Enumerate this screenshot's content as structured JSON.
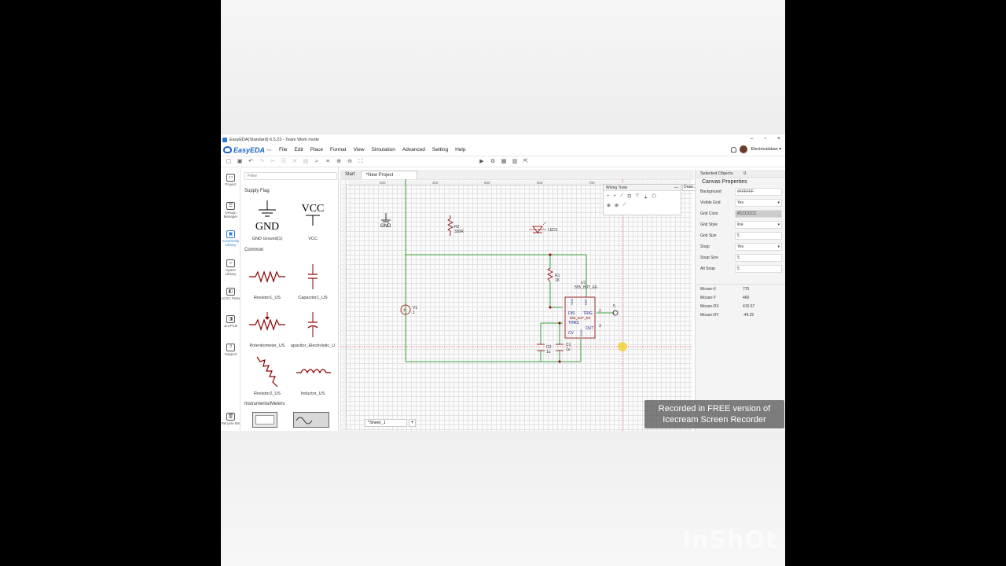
{
  "window": {
    "title": "EasyEDA(Standard) 6.5.23 - Team Work mode",
    "min": "–",
    "max": "▫",
    "close": "×"
  },
  "logo": {
    "text": "EasyEDA",
    "edition": "Std"
  },
  "menu": [
    "File",
    "Edit",
    "Place",
    "Format",
    "View",
    "Simulation",
    "Advanced",
    "Setting",
    "Help"
  ],
  "user": {
    "name": "Electricalsban ▾"
  },
  "rail": [
    {
      "label": "Project",
      "icon": "folder-icon"
    },
    {
      "label": "Design Manager",
      "icon": "tree-icon"
    },
    {
      "label": "Commonly Library",
      "icon": "chip-icon",
      "active": true
    },
    {
      "label": "Space Library",
      "icon": "search-icon"
    },
    {
      "label": "LCSC Parts",
      "icon": "lcsc-icon"
    },
    {
      "label": "JLCPCB",
      "icon": "jlc-icon"
    },
    {
      "label": "Support",
      "icon": "help-icon"
    },
    {
      "label": "Recycle Bin",
      "icon": "trash-icon"
    }
  ],
  "library": {
    "filter_placeholder": "Filter",
    "cat_supply": "Supply Flag",
    "cat_common": "Common",
    "cat_instruments": "Instruments/Meters",
    "items": [
      {
        "label": "GND Ground(1)"
      },
      {
        "label": "VCC"
      },
      {
        "label": "Resistor1_US"
      },
      {
        "label": "Capacitor1_US"
      },
      {
        "label": "Potentiometer_US"
      },
      {
        "label": "apacitor_Electrolytic_U"
      },
      {
        "label": "Resistor2_US"
      },
      {
        "label": "Inductor_US"
      }
    ]
  },
  "tabs": {
    "start": "Start",
    "project": "*New Project"
  },
  "ruler": {
    "t1": "300",
    "t2": "400",
    "t3": "500",
    "t4": "600",
    "t5": "700"
  },
  "sheet": {
    "name": "*Sheet_1",
    "add": "+"
  },
  "wiring": {
    "title": "Wiring Tools",
    "close": "—"
  },
  "draw": {
    "label": "Draw..."
  },
  "schematic": {
    "gnd": "GND",
    "r2_name": "R2",
    "r2_val": "330R",
    "led": "LED1",
    "r1_name": "R1",
    "r1_val": "1K",
    "v1": "V1",
    "v1_val": "1",
    "u1": "U1",
    "u1_part": "555_BJT_EE",
    "ic_part": "555_BJT_EE",
    "pin_dis": "DIS",
    "pin_thrs": "THRS",
    "pin_cv": "CV",
    "pin_trig": "TRIG",
    "pin_out": "OUT",
    "pin_vcc": "VCC",
    "pin_rst": "RST",
    "pin_gnd": "GND",
    "c2_name": "C2",
    "c2_val": "1u",
    "c1_name": "C1",
    "c1_val": "1u",
    "n2": "2",
    "n3": "3",
    "n5": "5"
  },
  "props": {
    "selected": "Selected Objects",
    "selected_count": "0",
    "title": "Canvas Properties",
    "rows": [
      {
        "key": "Background",
        "value": "#FFFFFF"
      },
      {
        "key": "Visible Grid",
        "value": "Yes"
      },
      {
        "key": "Grid Color",
        "value": "#CCCCCC"
      },
      {
        "key": "Grid Style",
        "value": "line"
      },
      {
        "key": "Grid Size",
        "value": "5"
      },
      {
        "key": "Snap",
        "value": "Yes"
      },
      {
        "key": "Snap Size",
        "value": "5"
      },
      {
        "key": "Alt Snap",
        "value": "5"
      }
    ],
    "mouse": [
      {
        "key": "Mouse-X",
        "value": "775"
      },
      {
        "key": "Mouse-Y",
        "value": "460"
      },
      {
        "key": "Mouse-DX",
        "value": "410.57"
      },
      {
        "key": "Mouse-DY",
        "value": "-49.25"
      }
    ]
  },
  "watermark": {
    "line1": "Recorded in FREE version of",
    "line2": "Icecream   Screen   Recorder"
  },
  "inshot": "InShOt",
  "colors": {
    "wire": "#3aa03a",
    "component": "#8b0000",
    "accent": "#2a7ad3",
    "cursor": "#f2d23c"
  }
}
